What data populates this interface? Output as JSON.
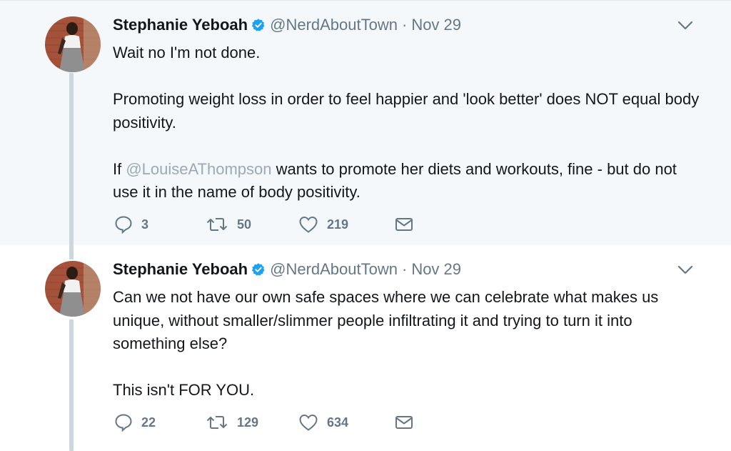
{
  "tweets": [
    {
      "author_name": "Stephanie Yeboah",
      "handle": "@NerdAboutTown",
      "separator": "·",
      "date": "Nov 29",
      "paragraphs": [
        "Wait no I'm not done.",
        "Promoting weight loss in order to feel happier and 'look better' does NOT equal body positivity."
      ],
      "p3_prefix": "If ",
      "p3_mention": "@LouiseAThompson",
      "p3_suffix": " wants to promote her diets and workouts, fine - but do not use it in the name of body positivity.",
      "replies": "3",
      "retweets": "50",
      "likes": "219"
    },
    {
      "author_name": "Stephanie Yeboah",
      "handle": "@NerdAboutTown",
      "separator": "·",
      "date": "Nov 29",
      "paragraphs": [
        "Can we not have our own safe spaces where we can celebrate what makes us unique, without smaller/slimmer people infiltrating it and trying to turn it into something else?",
        "This isn't FOR YOU."
      ],
      "replies": "22",
      "retweets": "129",
      "likes": "634"
    }
  ],
  "icons": {
    "verified": "verified-badge-icon",
    "caret": "chevron-down-icon",
    "reply": "reply-icon",
    "retweet": "retweet-icon",
    "like": "heart-icon",
    "dm": "envelope-icon"
  },
  "colors": {
    "verified": "#1da1f2",
    "icon_gray": "#657786",
    "mention": "#9aaab6",
    "first_bg": "#f5f8fa",
    "thread_line": "#ccd6dd"
  }
}
